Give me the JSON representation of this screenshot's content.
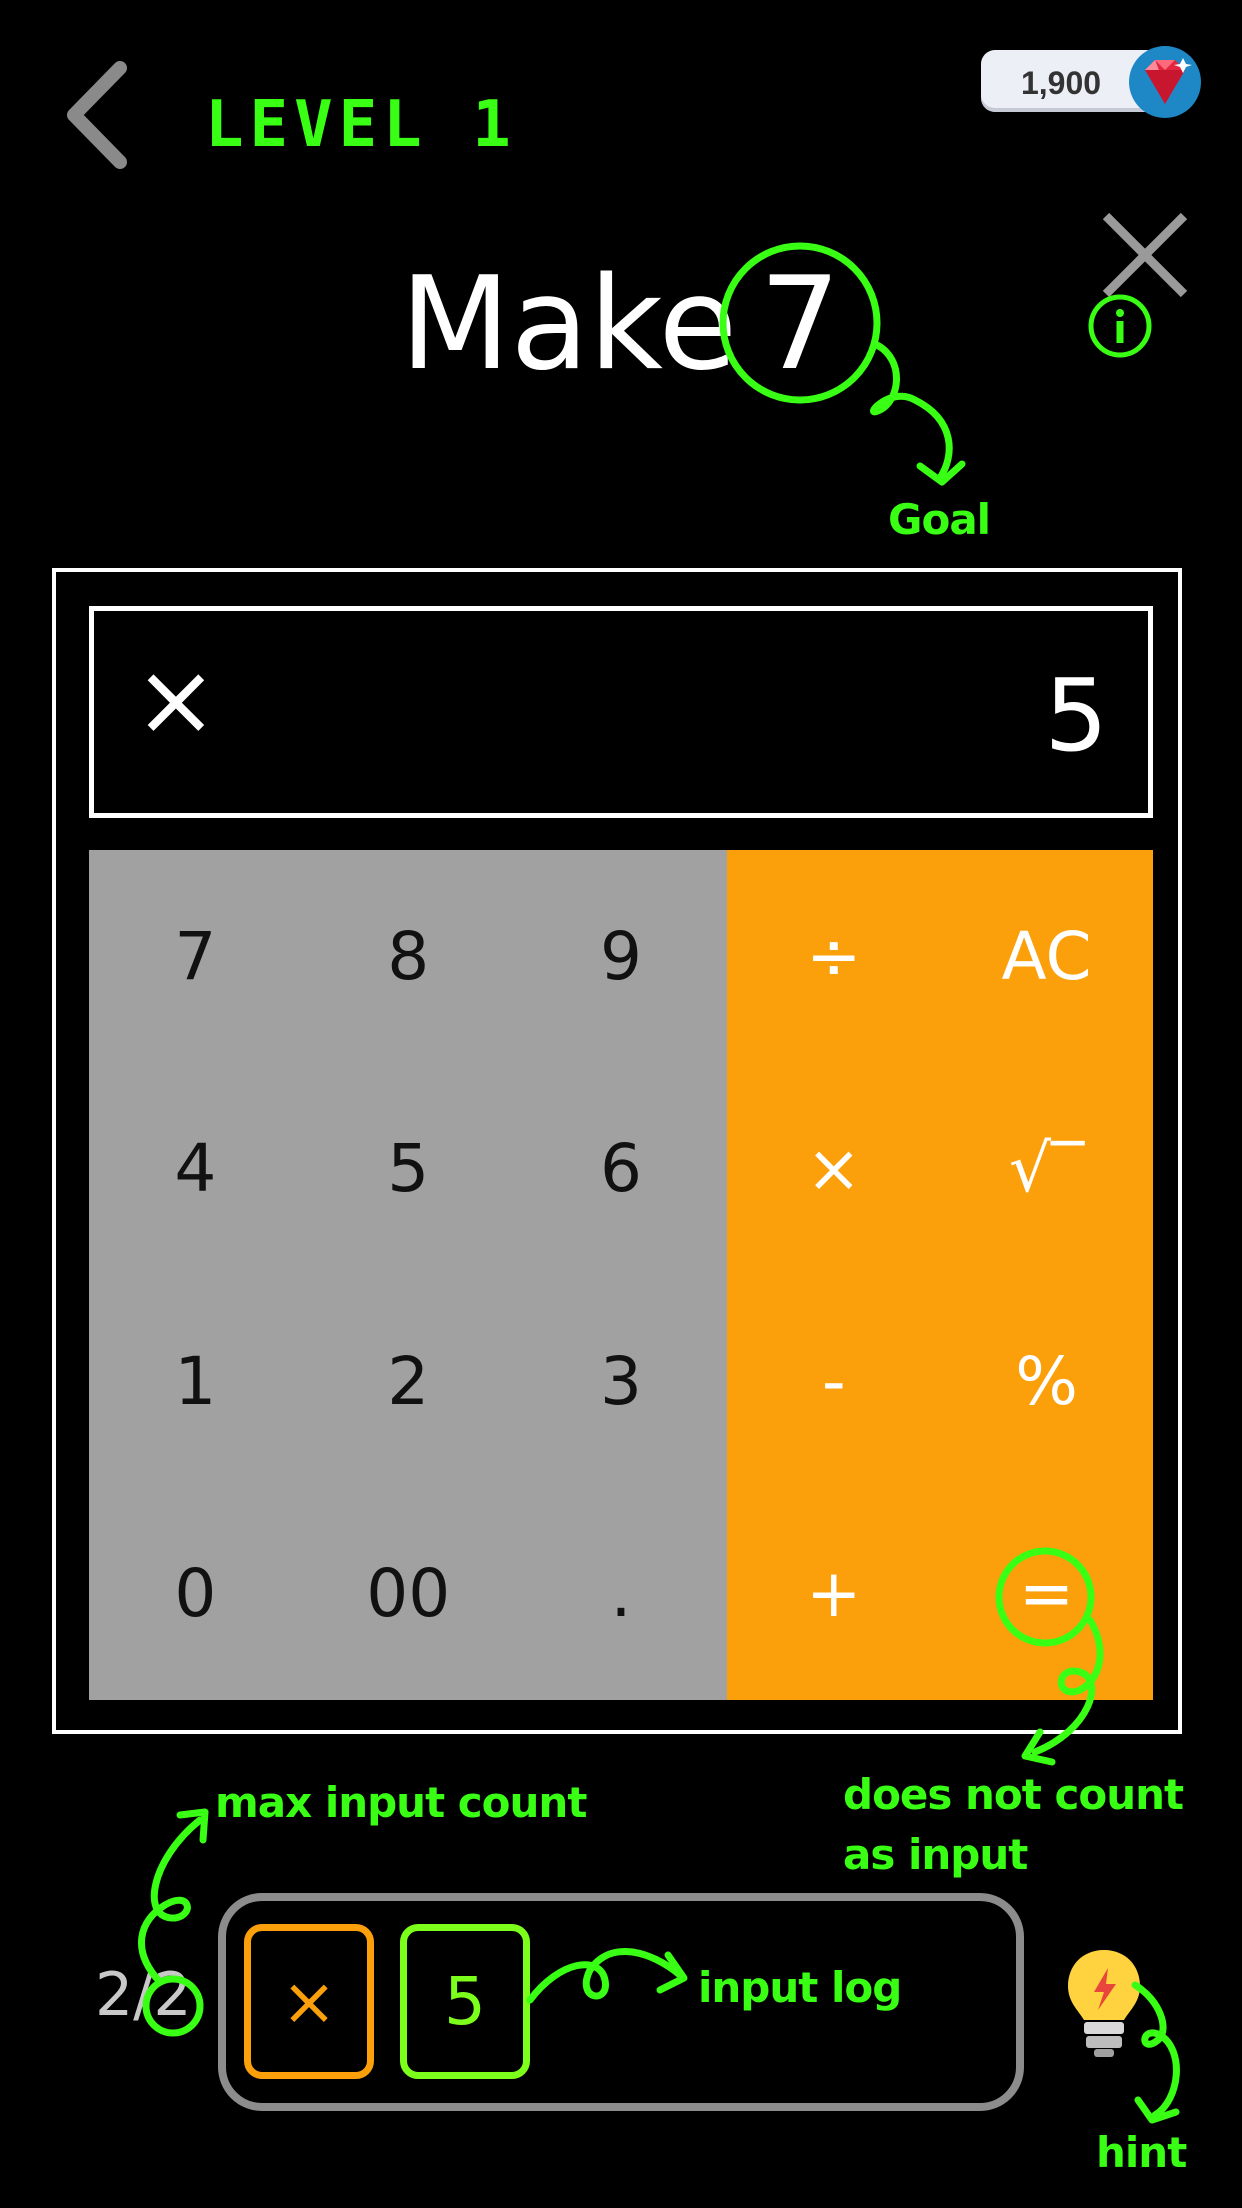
{
  "header": {
    "back_icon": "chevron-left-icon",
    "level_label": "LEVEL 1",
    "gems": {
      "count": "1,900",
      "icon": "ruby-gem-icon"
    },
    "close_icon": "close-icon",
    "info_icon": "info-icon"
  },
  "title": {
    "prefix": "Make",
    "goal": "7"
  },
  "annotations": {
    "goal": "Goal",
    "equals_note_line1": "does not count",
    "equals_note_line2": "as input",
    "max_input": "max input count",
    "input_log": "input log",
    "hint": "hint"
  },
  "display": {
    "operator": "×",
    "value": "5"
  },
  "keypad": {
    "rows": [
      [
        {
          "label": "7",
          "kind": "num"
        },
        {
          "label": "8",
          "kind": "num"
        },
        {
          "label": "9",
          "kind": "num"
        },
        {
          "label": "÷",
          "kind": "op"
        },
        {
          "label": "AC",
          "kind": "op"
        }
      ],
      [
        {
          "label": "4",
          "kind": "num"
        },
        {
          "label": "5",
          "kind": "num"
        },
        {
          "label": "6",
          "kind": "num"
        },
        {
          "label": "×",
          "kind": "op"
        },
        {
          "label": "√‾",
          "kind": "op"
        }
      ],
      [
        {
          "label": "1",
          "kind": "num"
        },
        {
          "label": "2",
          "kind": "num"
        },
        {
          "label": "3",
          "kind": "num"
        },
        {
          "label": "-",
          "kind": "op"
        },
        {
          "label": "%",
          "kind": "op"
        }
      ],
      [
        {
          "label": "0",
          "kind": "num"
        },
        {
          "label": "00",
          "kind": "num"
        },
        {
          "label": ".",
          "kind": "num"
        },
        {
          "label": "+",
          "kind": "op"
        },
        {
          "label": "=",
          "kind": "op"
        }
      ]
    ]
  },
  "input_log": {
    "count": "2/2",
    "entries": [
      "×",
      "5"
    ]
  },
  "hint": {
    "icon": "lightbulb-icon"
  },
  "colors": {
    "accent_green": "#39ff14",
    "operator_orange": "#fb9f0b",
    "number_gray": "#a1a1a1"
  }
}
